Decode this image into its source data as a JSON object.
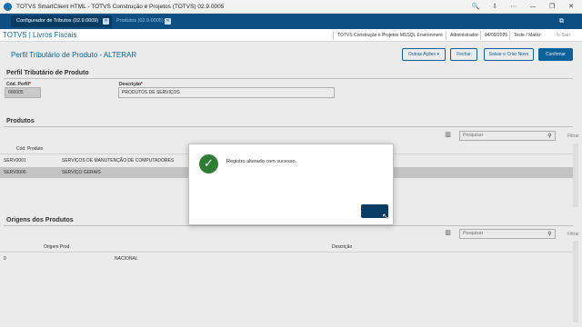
{
  "window": {
    "title": "TOTVS SmartClient HTML - TOTVS Construção e Projetos (TOTVS) 02.9.0005",
    "controls": [
      "🔍",
      "⇩",
      "⋯",
      "—",
      "❐",
      "✕"
    ]
  },
  "tabs": [
    {
      "label": "Configurador de Tributos (02.9.0009)",
      "active": true
    },
    {
      "label": "Produtos (02.9.0005)",
      "active": false
    }
  ],
  "tab_close": "✕",
  "header": {
    "brand": "TOTVS | Livros Fiscais",
    "environment": "TOTVS Construção e Projetos MSSQL Environment",
    "user": "Administrador",
    "date": "04/09/2025",
    "branch": "Teste / Matriz",
    "mini_labels": [
      "⧉",
      "↻ Sair"
    ]
  },
  "page": {
    "title": "Perfil Tributário de Produto - ALTERAR",
    "buttons": {
      "more_actions": "Outras Ações",
      "more_actions_caret": "▾",
      "close": "Fechar",
      "save_new": "Salvar e Criar Novo",
      "confirm": "Confirmar"
    }
  },
  "perfil": {
    "section_title": "Perfil Tributário de Produto",
    "code_label": "Cód. Perfil",
    "code_value": "000005",
    "desc_label": "Descrição",
    "desc_value": "PRODUTOS DE SERVIÇOS",
    "required_mark": "*"
  },
  "produtos": {
    "section_title": "Produtos",
    "search_placeholder": "Pesquisar",
    "filter_label": "Filtrar",
    "col_icon": "▥",
    "search_icon": "⚲",
    "columns": [
      "Cód. Produto"
    ],
    "rows": [
      {
        "code": "SERV0001",
        "desc": "SERVIÇOS DE MANUTENÇÃO DE COMPUTADORES",
        "selected": false
      },
      {
        "code": "SERV0006",
        "desc": "SERVIÇO GERAIS",
        "selected": true
      }
    ]
  },
  "origens": {
    "section_title": "Origens dos Produtos",
    "search_placeholder": "Pesquisar",
    "filter_label": "Filtrar",
    "col_icon": "▥",
    "search_icon": "⚲",
    "columns": [
      "Origem Prod.",
      "Descrição"
    ],
    "rows": [
      {
        "origem": "0",
        "descricao": "NACIONAL"
      }
    ]
  },
  "modal": {
    "check_icon": "✓",
    "message": "Registro alterado com sucesso.",
    "ok_label": ""
  },
  "cursor_icon": "↖"
}
